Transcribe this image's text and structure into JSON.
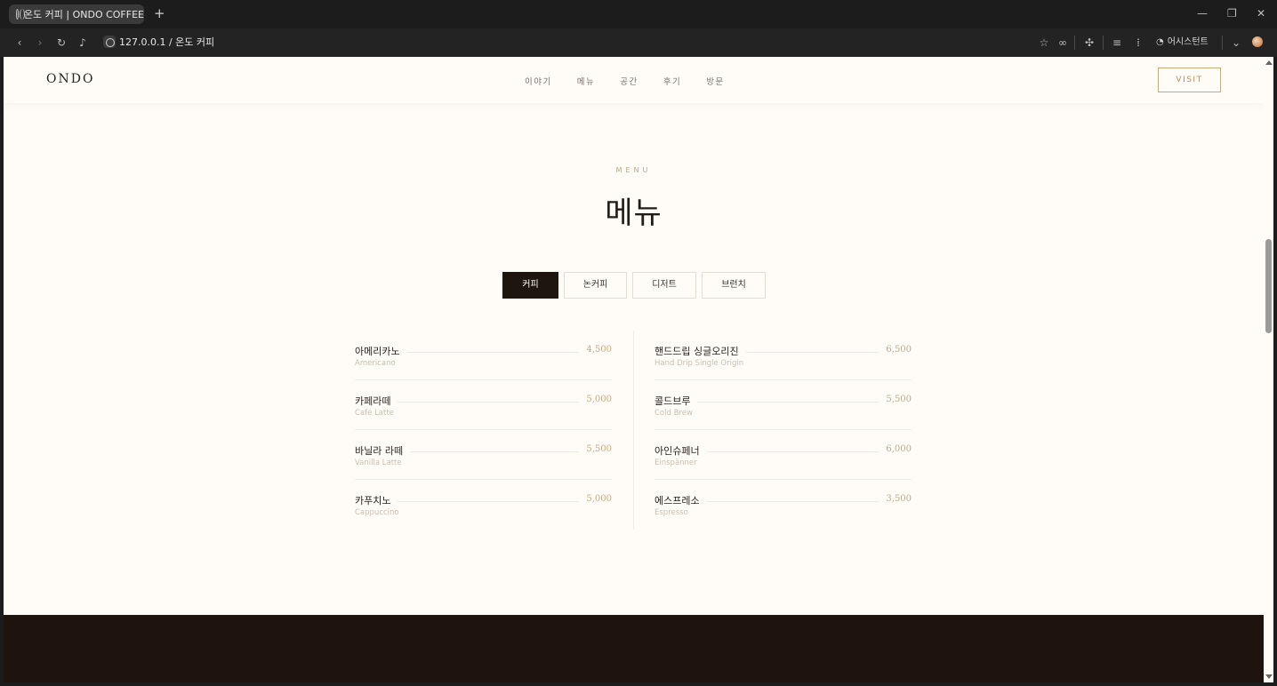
{
  "browser": {
    "tab_title": "온도 커피 | ONDO COFFEE",
    "new_tab": "+",
    "address": "127.0.0.1 / 온도 커피",
    "assistant": "어시스턴트",
    "icons": [
      "back-icon",
      "forward-icon",
      "reload-icon",
      "mic-icon",
      "star-icon",
      "link-icon",
      "extensions-icon",
      "list-icon",
      "voice-icon",
      "assistant-icon",
      "chevron-down-icon",
      "profile-avatar"
    ],
    "window_controls": [
      "minimize",
      "restore",
      "close"
    ]
  },
  "site": {
    "logo": "ONDO",
    "nav": [
      "이야기",
      "메뉴",
      "공간",
      "후기",
      "방문"
    ],
    "visit": "VISIT"
  },
  "menu_section": {
    "eyebrow": "MENU",
    "title": "메뉴",
    "tabs": [
      {
        "label": "커피",
        "active": true
      },
      {
        "label": "논커피",
        "active": false
      },
      {
        "label": "디저트",
        "active": false
      },
      {
        "label": "브런치",
        "active": false
      }
    ],
    "left_items": [
      {
        "name": "아메리카노",
        "en": "Americano",
        "price": "4,500"
      },
      {
        "name": "카페라떼",
        "en": "Café Latte",
        "price": "5,000"
      },
      {
        "name": "바닐라 라떼",
        "en": "Vanilla Latte",
        "price": "5,500"
      },
      {
        "name": "카푸치노",
        "en": "Cappuccino",
        "price": "5,000"
      }
    ],
    "right_items": [
      {
        "name": "핸드드립 싱글오리진",
        "en": "Hand Drip Single Origin",
        "price": "6,500"
      },
      {
        "name": "콜드브루",
        "en": "Cold Brew",
        "price": "5,500"
      },
      {
        "name": "아인슈페너",
        "en": "Einspänner",
        "price": "6,000"
      },
      {
        "name": "에스프레소",
        "en": "Espresso",
        "price": "3,500"
      }
    ]
  },
  "colors": {
    "page_bg": "#fffcf8",
    "dark": "#1f150f",
    "gold": "#c4a97f"
  }
}
